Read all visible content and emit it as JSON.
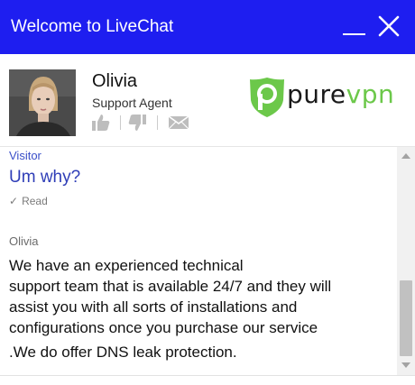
{
  "window": {
    "title": "Welcome to LiveChat",
    "minimize_icon": "minimize-icon",
    "close_icon": "close-icon",
    "title_bar_color": "#1e1ef0"
  },
  "agent": {
    "name": "Olivia",
    "role": "Support Agent",
    "rating_icons": [
      "thumbs-up-icon",
      "thumbs-down-icon",
      "envelope-icon"
    ]
  },
  "brand": {
    "logo_text_prefix": "pure",
    "logo_text_suffix": "vpn",
    "accent_color": "#6cc84a"
  },
  "messages": [
    {
      "author": "Visitor",
      "text": "Um why?",
      "status": "Read"
    },
    {
      "author": "Olivia",
      "text": "We have an experienced technical\nsupport team that is available 24/7 and they will\nassist you with all sorts of installations and\nconfigurations once you purchase our service",
      "text2": ".We do offer DNS leak protection."
    }
  ]
}
